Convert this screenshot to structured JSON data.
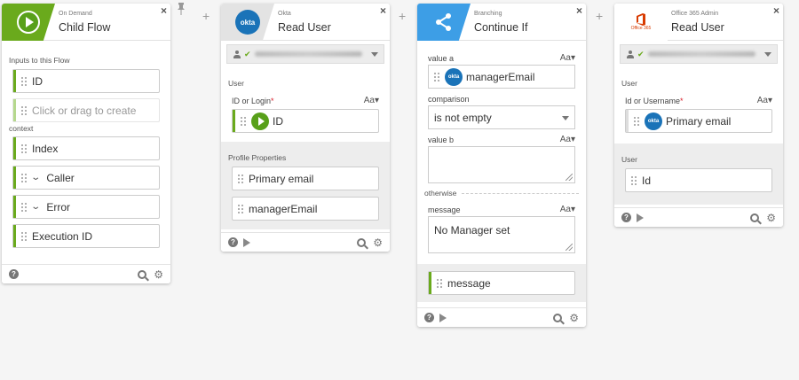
{
  "card1": {
    "subtitle": "On Demand",
    "title": "Child Flow",
    "inputs_label": "Inputs to this Flow",
    "inputs": [
      "ID"
    ],
    "create_placeholder": "Click or drag to create",
    "context_label": "context",
    "context_items": [
      "Index",
      "Caller",
      "Error",
      "Execution ID"
    ]
  },
  "card2": {
    "subtitle": "Okta",
    "title": "Read User",
    "icon_text": "okta",
    "user_label": "User",
    "field_label": "ID or Login",
    "field_value": "ID",
    "profile_label": "Profile Properties",
    "outputs": [
      "Primary email",
      "managerEmail"
    ]
  },
  "card3": {
    "subtitle": "Branching",
    "title": "Continue If",
    "value_a_label": "value a",
    "value_a": "managerEmail",
    "comparison_label": "comparison",
    "comparison": "is not empty",
    "value_b_label": "value b",
    "otherwise_label": "otherwise",
    "message_label": "message",
    "message_value": "No Manager set",
    "output": "message"
  },
  "card4": {
    "subtitle": "Office 365 Admin",
    "title": "Read User",
    "logo_text": "Office 365",
    "user_label": "User",
    "field_label": "Id or Username",
    "field_value": "Primary email",
    "out_user_label": "User",
    "output": "Id"
  },
  "common": {
    "close": "×",
    "aa": "Aa▾",
    "required": "*",
    "help": "?",
    "plus": "+",
    "gear": "⚙",
    "check": "✔"
  },
  "colors": {
    "green": "#6aaa1c",
    "blue": "#3d9ee6",
    "okta": "#1a73b8",
    "office": "#d83b01"
  }
}
